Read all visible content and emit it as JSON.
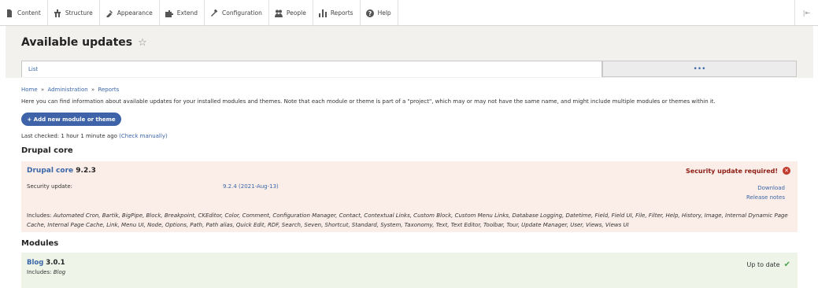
{
  "toolbar": {
    "items": [
      {
        "label": "Content",
        "icon": "content-icon"
      },
      {
        "label": "Structure",
        "icon": "structure-icon"
      },
      {
        "label": "Appearance",
        "icon": "appearance-icon"
      },
      {
        "label": "Extend",
        "icon": "extend-icon"
      },
      {
        "label": "Configuration",
        "icon": "configuration-icon"
      },
      {
        "label": "People",
        "icon": "people-icon"
      },
      {
        "label": "Reports",
        "icon": "reports-icon"
      },
      {
        "label": "Help",
        "icon": "help-icon"
      }
    ],
    "collapse_icon": "|⇤"
  },
  "page": {
    "title": "Available updates",
    "star": "☆",
    "tab_list": "List",
    "tab_more": "•••"
  },
  "breadcrumb": [
    "Home",
    "Administration",
    "Reports"
  ],
  "breadcrumb_sep": "»",
  "intro": "Here you can find information about available updates for your installed modules and themes. Note that each module or theme is part of a \"project\", which may or may not have the same name, and might include multiple modules or themes within it.",
  "add_button": "+ Add new module or theme",
  "last_checked": {
    "text": "Last checked: 1 hour 1 minute ago",
    "link": "(Check manually)"
  },
  "core": {
    "heading": "Drupal core",
    "name": "Drupal core",
    "version": "9.2.3",
    "status": "Security update required!",
    "security_label": "Security update:",
    "security_version": "9.2.4 (2021-Aug-13)",
    "download": "Download",
    "release_notes": "Release notes",
    "includes_label": "Includes:",
    "includes": "Automated Cron, Bartik, BigPipe, Block, Breakpoint, CKEditor, Color, Comment, Configuration Manager, Contact, Contextual Links, Custom Block, Custom Menu Links, Database Logging, Datetime, Field, Field UI, File, Filter, Help, History, Image, Internal Dynamic Page Cache, Internal Page Cache, Link, Menu UI, Node, Options, Path, Path alias, Quick Edit, RDF, Search, Seven, Shortcut, Standard, System, Taxonomy, Text, Text Editor, Toolbar, Tour, Update Manager, User, Views, Views UI"
  },
  "modules": {
    "heading": "Modules",
    "items": [
      {
        "name": "Blog",
        "version": "3.0.1",
        "includes_label": "Includes:",
        "includes": "Blog",
        "status": "Up to date"
      }
    ]
  },
  "colors": {
    "accent": "#3a66a8",
    "error": "#8c1c14",
    "error_bg": "#fbeee8",
    "ok_bg": "#eef5e8"
  }
}
